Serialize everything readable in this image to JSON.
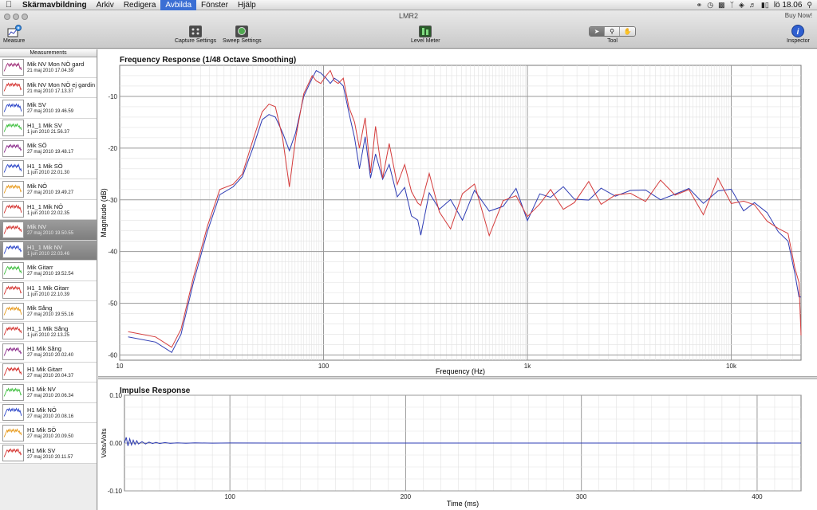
{
  "menubar": {
    "apple": "",
    "app_name": "Skärmavbildning",
    "items": [
      "Arkiv",
      "Redigera",
      "Avbilda",
      "Fönster",
      "Hjälp"
    ],
    "active_item": "Avbilda",
    "clock": "lö 18.06"
  },
  "window": {
    "title": "LMR2",
    "buy_now": "Buy Now!"
  },
  "toolbar": {
    "measure": "Measure",
    "capture_settings": "Capture Settings",
    "sweep_settings": "Sweep Settings",
    "level_meter": "Level Meter",
    "tool": "Tool",
    "inspector": "Inspector"
  },
  "sidebar": {
    "header": "Measurements",
    "items": [
      {
        "name": "Mik NV Mon NÖ gard",
        "date": "21 maj 2010 17.04.39",
        "color": "#a0307a"
      },
      {
        "name": "Mik NV Mon NÖ ej gardin",
        "date": "21 maj 2010 17.13.37",
        "color": "#d4302c"
      },
      {
        "name": "Mik SV",
        "date": "27 maj 2010 19.46.59",
        "color": "#2b45c8"
      },
      {
        "name": "H1_1 Mik SV",
        "date": "1 jun 2010 21.56.37",
        "color": "#3fbf3f"
      },
      {
        "name": "Mik SÖ",
        "date": "27 maj 2010 19.48.17",
        "color": "#8a2a8a"
      },
      {
        "name": "H1_1 Mik SÖ",
        "date": "1 jun 2010 22.01.30",
        "color": "#2b45c8"
      },
      {
        "name": "Mik NÖ",
        "date": "27 maj 2010 19.49.27",
        "color": "#e89a1c"
      },
      {
        "name": "H1_1 Mik NÖ",
        "date": "1 jun 2010 22.02.35",
        "color": "#d4302c"
      },
      {
        "name": "Mik NV",
        "date": "27 maj 2010 19.50.55",
        "color": "#d4302c",
        "selected": true
      },
      {
        "name": "H1_1 Mik NV",
        "date": "1 jun 2010 22.03.46",
        "color": "#2b45c8",
        "selected": true
      },
      {
        "name": "Mik Gitarr",
        "date": "27 maj 2010 19.52.54",
        "color": "#3fbf3f"
      },
      {
        "name": "H1_1 Mik Gitarr",
        "date": "1 jun 2010 22.10.39",
        "color": "#d4302c"
      },
      {
        "name": "Mik Sång",
        "date": "27 maj 2010 19.55.16",
        "color": "#e89a1c"
      },
      {
        "name": "H1_1 Mik Sång",
        "date": "1 jun 2010 22.13.25",
        "color": "#d4302c"
      },
      {
        "name": "H1 Mik Sång",
        "date": "27 maj 2010 20.02.40",
        "color": "#8a2a8a"
      },
      {
        "name": "H1 Mik Gitarr",
        "date": "27 maj 2010 20.04.37",
        "color": "#d4302c"
      },
      {
        "name": "H1 Mik NV",
        "date": "27 maj 2010 20.06.34",
        "color": "#3fbf3f"
      },
      {
        "name": "H1 Mik NÖ",
        "date": "27 maj 2010 20.08.16",
        "color": "#2b45c8"
      },
      {
        "name": "H1 Mik SÖ",
        "date": "27 maj 2010 20.09.50",
        "color": "#e89a1c"
      },
      {
        "name": "H1 Mik SV",
        "date": "27 maj 2010 20.11.57",
        "color": "#d4302c"
      }
    ]
  },
  "chart_data": [
    {
      "type": "line",
      "title": "Frequency Response (1/48 Octave Smoothing)",
      "xlabel": "Frequency (Hz)",
      "ylabel": "Magnitude (dB)",
      "xscale": "log",
      "xlim": [
        10,
        22000
      ],
      "ylim": [
        -61,
        -4
      ],
      "xticks": [
        {
          "v": 10,
          "label": "10"
        },
        {
          "v": 100,
          "label": "100"
        },
        {
          "v": 1000,
          "label": "1k"
        },
        {
          "v": 10000,
          "label": "10k"
        }
      ],
      "yticks": [
        -10,
        -20,
        -30,
        -40,
        -50,
        -60
      ],
      "grid": true,
      "series": [
        {
          "color": "#2e3cb4",
          "x": [
            11,
            15,
            18,
            20,
            23,
            27,
            31,
            36,
            40,
            45,
            50,
            54,
            58,
            63,
            68,
            73,
            80,
            88,
            92,
            97,
            103,
            108,
            113,
            118,
            125,
            133,
            142,
            150,
            160,
            170,
            180,
            195,
            210,
            230,
            250,
            270,
            290,
            300,
            330,
            370,
            420,
            480,
            550,
            650,
            760,
            880,
            1000,
            1150,
            1300,
            1500,
            1700,
            2000,
            2300,
            2700,
            3200,
            3800,
            4500,
            5300,
            6200,
            7300,
            8600,
            10000,
            11500,
            13000,
            15000,
            17000,
            19000,
            20500,
            21500,
            22000
          ],
          "y": [
            -56.5,
            -57.5,
            -59.5,
            -56,
            -46,
            -36,
            -29,
            -27.5,
            -25.5,
            -20,
            -14.5,
            -13.5,
            -14,
            -17,
            -20.5,
            -17,
            -10,
            -6.5,
            -5,
            -5.5,
            -6.5,
            -7.5,
            -6.5,
            -7,
            -8,
            -13,
            -18,
            -24,
            -19,
            -25,
            -21,
            -27,
            -22,
            -30,
            -28,
            -32,
            -35,
            -36.5,
            -28,
            -33,
            -29,
            -34,
            -29,
            -31,
            -32,
            -28,
            -33,
            -30,
            -29,
            -27,
            -31,
            -29,
            -28,
            -30,
            -27,
            -29,
            -30,
            -28,
            -29,
            -30,
            -28,
            -29,
            -31,
            -31,
            -33,
            -35,
            -39,
            -44,
            -48,
            -50
          ]
        },
        {
          "color": "#d43c3c",
          "x": [
            11,
            15,
            18,
            20,
            23,
            27,
            31,
            36,
            40,
            45,
            50,
            54,
            58,
            63,
            68,
            73,
            80,
            88,
            92,
            97,
            103,
            108,
            113,
            118,
            125,
            133,
            142,
            150,
            160,
            170,
            180,
            195,
            210,
            230,
            250,
            270,
            290,
            300,
            330,
            370,
            420,
            480,
            550,
            650,
            760,
            880,
            1000,
            1150,
            1300,
            1500,
            1700,
            2000,
            2300,
            2700,
            3200,
            3800,
            4500,
            5300,
            6200,
            7300,
            8600,
            10000,
            11500,
            13000,
            15000,
            17000,
            19000,
            20500,
            21500,
            22000
          ],
          "y": [
            -55.5,
            -56.5,
            -58.5,
            -55,
            -45,
            -35,
            -28,
            -27,
            -25,
            -18.5,
            -13,
            -11.5,
            -12,
            -18,
            -27.5,
            -18,
            -9.5,
            -6,
            -7,
            -7.5,
            -6,
            -5,
            -7,
            -7.5,
            -6.5,
            -12,
            -15,
            -20,
            -14,
            -24,
            -17,
            -25,
            -19,
            -28,
            -22,
            -29,
            -31,
            -30,
            -26,
            -32,
            -35,
            -30,
            -26,
            -37,
            -31,
            -28,
            -34,
            -31,
            -27,
            -33,
            -30,
            -26,
            -32,
            -28,
            -29,
            -31,
            -25,
            -30,
            -28,
            -32,
            -27,
            -30,
            -30,
            -32,
            -33,
            -36,
            -37,
            -42,
            -47,
            -56
          ]
        }
      ]
    },
    {
      "type": "line",
      "title": "Impulse Response",
      "xlabel": "Time (ms)",
      "ylabel": "Volts/Volts",
      "xlim": [
        40,
        425
      ],
      "ylim": [
        -0.1,
        0.1
      ],
      "xticks": [
        100,
        200,
        300,
        400
      ],
      "yticks": [
        {
          "v": 0.1,
          "label": "0.10"
        },
        {
          "v": 0.0,
          "label": "0.00"
        },
        {
          "v": -0.1,
          "label": "-0.10"
        }
      ],
      "grid": true,
      "series": [
        {
          "color": "#2e3cb4",
          "x": [
            40,
            41,
            42,
            43,
            44,
            45,
            46,
            47,
            48,
            50,
            52,
            54,
            56,
            58,
            60,
            63,
            66,
            70,
            75,
            80,
            90,
            100,
            125,
            150,
            200,
            250,
            300,
            350,
            400,
            425
          ],
          "y": [
            0,
            0.012,
            -0.006,
            0.009,
            -0.004,
            0.006,
            -0.003,
            0.005,
            -0.002,
            0.003,
            -0.002,
            0.002,
            -0.001,
            0.0015,
            -0.001,
            0.001,
            -0.0007,
            0.0005,
            -0.0004,
            0.0003,
            -0.0002,
            0.0001,
            0,
            0,
            0,
            0,
            0,
            0,
            0,
            0
          ]
        }
      ]
    }
  ]
}
